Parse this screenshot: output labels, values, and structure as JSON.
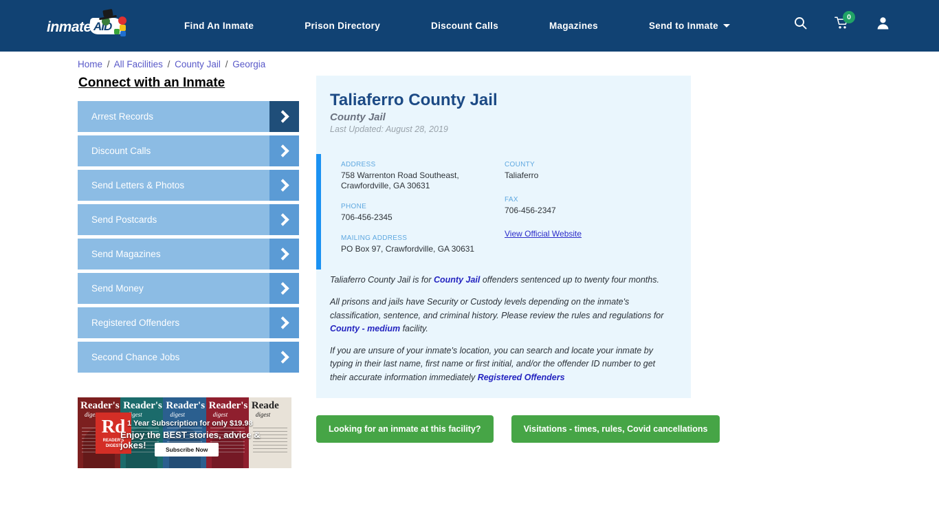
{
  "header": {
    "logo": {
      "word": "inmate",
      "badge": "AID",
      "alt": "InmateAid logo"
    },
    "nav": [
      {
        "label": "Find An Inmate",
        "dropdown": false
      },
      {
        "label": "Prison Directory",
        "dropdown": false
      },
      {
        "label": "Discount Calls",
        "dropdown": false
      },
      {
        "label": "Magazines",
        "dropdown": false
      },
      {
        "label": "Send to Inmate",
        "dropdown": true
      }
    ],
    "icons": {
      "search": "search-icon",
      "cart": "shopping-cart-icon",
      "cart_count": "0",
      "account": "user-account-icon"
    },
    "background": "#114273",
    "badge_color": "#21a366"
  },
  "breadcrumb": {
    "items": [
      "Home",
      "All Facilities",
      "County Jail",
      "Georgia"
    ],
    "separator": "/"
  },
  "sidebar": {
    "title": "Connect with an Inmate",
    "items": [
      {
        "label": "Arrest Records",
        "active": true
      },
      {
        "label": "Discount Calls",
        "active": false
      },
      {
        "label": "Send Letters & Photos",
        "active": false
      },
      {
        "label": "Send Postcards",
        "active": false
      },
      {
        "label": "Send Magazines",
        "active": false
      },
      {
        "label": "Send Money",
        "active": false
      },
      {
        "label": "Registered Offenders",
        "active": false
      },
      {
        "label": "Second Chance Jobs",
        "active": false
      }
    ],
    "item_bg": "#8cbce4",
    "arrow_bg": "#5b9bd5",
    "arrow_bg_active": "#1f4e79"
  },
  "ad": {
    "brand": "Reader's Digest",
    "logo_initials": "Rd",
    "logo_sub": "READER'S DIGEST",
    "headline": "1 Year Subscription for only $19.98",
    "subhead": "Enjoy the BEST stories, advice & jokes!",
    "cta": "Subscribe Now",
    "covers": [
      {
        "title": "Reader's",
        "sub": "digest"
      },
      {
        "title": "Reader's",
        "sub": "digest"
      },
      {
        "title": "Reader's",
        "sub": "digest"
      },
      {
        "title": "Reader's",
        "sub": "digest"
      },
      {
        "title": "Reade",
        "sub": "digest"
      }
    ]
  },
  "facility": {
    "name": "Taliaferro County Jail",
    "type": "County Jail",
    "last_updated": "Last Updated: August 28, 2019",
    "info": {
      "address_label": "ADDRESS",
      "address_value": "758 Warrenton Road Southeast, Crawfordville, GA 30631",
      "address_line1": "758 Warrenton Road Southeast,",
      "address_line2": "Crawfordville, GA 30631",
      "phone_label": "PHONE",
      "phone_value": "706-456-2345",
      "mailing_label": "MAILING ADDRESS",
      "mailing_value": "PO Box 97, Crawfordville, GA 30631",
      "county_label": "COUNTY",
      "county_value": "Taliaferro",
      "fax_label": "FAX",
      "fax_value": "706-456-2347",
      "website_link": "View Official Website"
    },
    "paragraphs": {
      "p1_a": "Taliaferro County Jail is for ",
      "p1_link": "County Jail",
      "p1_b": " offenders sentenced up to twenty four months.",
      "p2_a": "All prisons and jails have Security or Custody levels depending on the inmate's classification, sentence, and criminal history. Please review the rules and regulations for ",
      "p2_link": "County - medium",
      "p2_b": " facility.",
      "p3_a": "If you are unsure of your inmate's location, you can search and locate your inmate by typing in their last name, first name or first initial, and/or the offender ID number to get their accurate information immediately ",
      "p3_link": "Registered Offenders"
    },
    "buttons": [
      {
        "label": "Looking for an inmate at this facility?"
      },
      {
        "label": "Visitations - times, rules, Covid cancellations"
      }
    ],
    "panel_bg": "#eaf6fd",
    "accent_bar": "#1b92f2",
    "button_color": "#46a546"
  }
}
